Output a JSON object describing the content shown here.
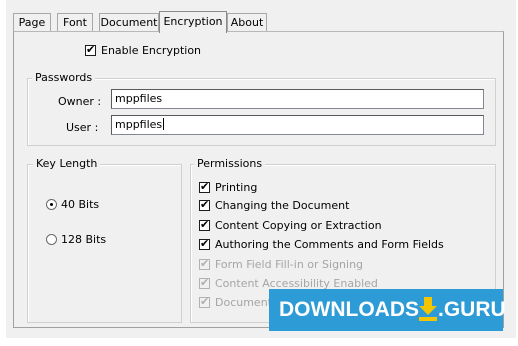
{
  "tabs": [
    {
      "label": "Page",
      "active": false
    },
    {
      "label": "Font",
      "active": false
    },
    {
      "label": "Document",
      "active": false
    },
    {
      "label": "Encryption",
      "active": true
    },
    {
      "label": "About",
      "active": false
    }
  ],
  "enable_encryption": {
    "label": "Enable Encryption",
    "checked": true
  },
  "passwords": {
    "title": "Passwords",
    "owner_label": "Owner :",
    "owner_value": "mppfiles",
    "user_label": "User :",
    "user_value": "mppfiles"
  },
  "key_length": {
    "title": "Key Length",
    "options": [
      {
        "label": "40 Bits",
        "selected": true
      },
      {
        "label": "128 Bits",
        "selected": false
      }
    ]
  },
  "permissions": {
    "title": "Permissions",
    "items": [
      {
        "label": "Printing",
        "checked": true,
        "enabled": true
      },
      {
        "label": "Changing the Document",
        "checked": true,
        "enabled": true
      },
      {
        "label": "Content Copying or Extraction",
        "checked": true,
        "enabled": true
      },
      {
        "label": "Authoring the Comments and Form Fields",
        "checked": true,
        "enabled": true
      },
      {
        "label": "Form Field Fill-in or Signing",
        "checked": true,
        "enabled": false
      },
      {
        "label": "Content Accessibility Enabled",
        "checked": true,
        "enabled": false
      },
      {
        "label": "Document Assembly",
        "checked": true,
        "enabled": false
      }
    ]
  },
  "watermark": {
    "text_left": "DOWNLOADS",
    "text_right": ".GURU",
    "background": "#2d9bd6",
    "arrow_color": "#f2c500"
  }
}
